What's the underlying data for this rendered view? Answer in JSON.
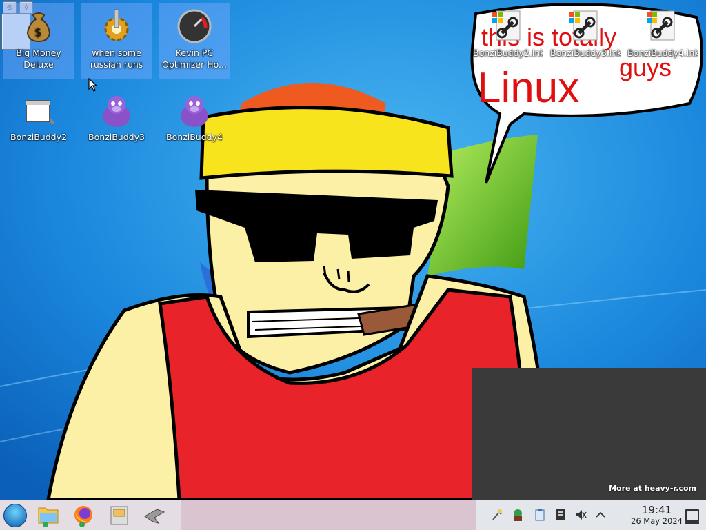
{
  "wallpaper": {
    "bubble_line1": "this is totally",
    "bubble_word": "Linux",
    "bubble_end": "guys"
  },
  "window_controls": {
    "btn1": "◎",
    "btn2": "◊"
  },
  "desktop_icons": [
    {
      "label": "Big Money Deluxe",
      "icon": "money-bag-icon"
    },
    {
      "label": "when some russian runs a...",
      "icon": "gear-icon"
    },
    {
      "label": "Kevin PC Optimizer Ho...",
      "icon": "speedometer-icon"
    },
    {
      "label": "BonziBuddy2",
      "icon": "window-icon"
    },
    {
      "label": "BonziBuddy3",
      "icon": "bonzi-gorilla-icon"
    },
    {
      "label": "BonziBuddy4",
      "icon": "bonzi-gorilla-icon"
    },
    {
      "label": "BonziBuddy2.lnk",
      "icon": "shortcut-icon"
    },
    {
      "label": "BonziBuddy3.lnk",
      "icon": "shortcut-icon"
    },
    {
      "label": "BonziBuddy4.lnk",
      "icon": "shortcut-icon"
    }
  ],
  "video_overlay": {
    "watermark": "More at heavy-r.com"
  },
  "taskbar": {
    "apps": [
      "start-menu-icon",
      "file-manager-icon",
      "firefox-icon",
      "archive-icon",
      "wine-app-icon"
    ],
    "tray": [
      "settings-icon",
      "bonzi-tray-icon",
      "clipboard-icon",
      "storage-icon",
      "volume-muted-icon",
      "tray-expand-icon"
    ],
    "clock_time": "19:41",
    "clock_date": "26 May 2024"
  },
  "colors": {
    "taskbar_pink": "#d9c4cf",
    "bubble_text": "#e01010",
    "wallpaper_blue": "#1a7fd6"
  }
}
